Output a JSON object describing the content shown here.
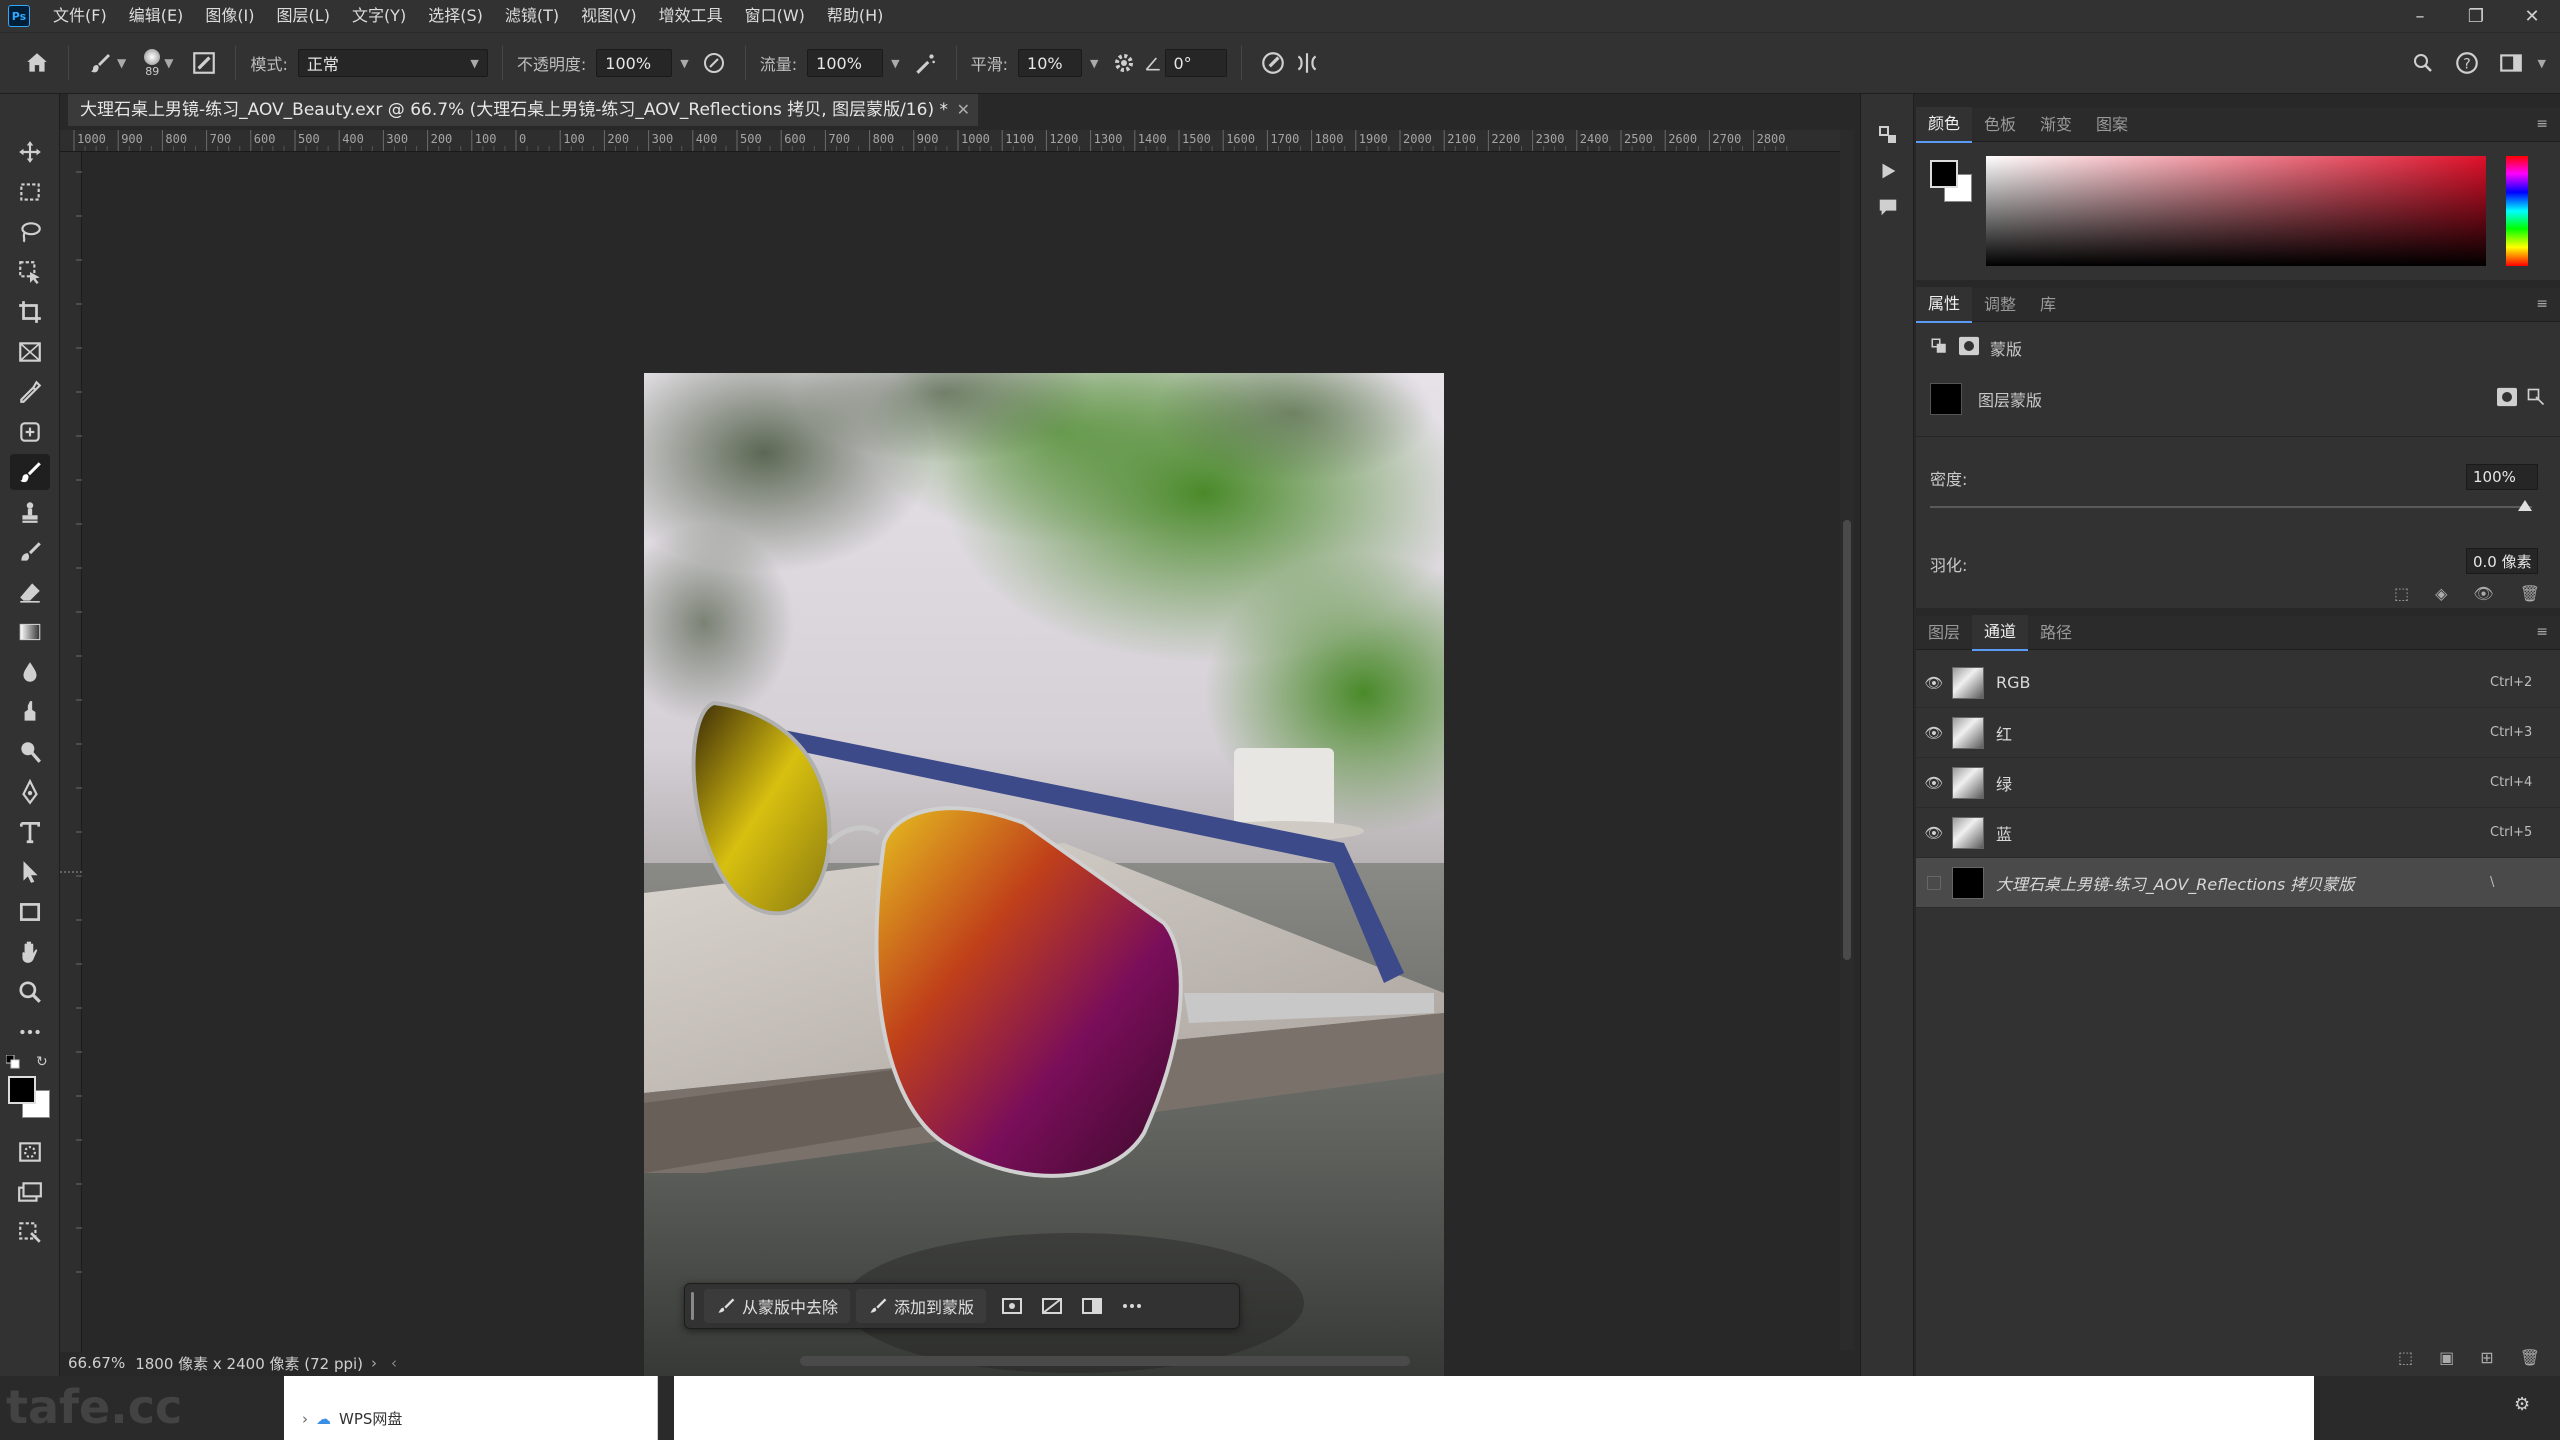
{
  "menu": {
    "items": [
      "文件(F)",
      "编辑(E)",
      "图像(I)",
      "图层(L)",
      "文字(Y)",
      "选择(S)",
      "滤镜(T)",
      "视图(V)",
      "增效工具",
      "窗口(W)",
      "帮助(H)"
    ]
  },
  "options": {
    "brush_size": "89",
    "mode_label": "模式:",
    "mode_value": "正常",
    "opacity_label": "不透明度:",
    "opacity_value": "100%",
    "flow_label": "流量:",
    "flow_value": "100%",
    "smooth_label": "平滑:",
    "smooth_value": "10%",
    "angle_value": "0°"
  },
  "document": {
    "tab_title": "大理石桌上男镜-练习_AOV_Beauty.exr @ 66.7% (大理石桌上男镜-练习_AOV_Reflections 拷贝, 图层蒙版/16) *",
    "zoom": "66.67%",
    "dimensions": "1800 像素 x 2400 像素 (72 ppi)"
  },
  "ruler": {
    "top_labels": [
      "1000",
      "900",
      "800",
      "700",
      "600",
      "500",
      "400",
      "300",
      "200",
      "100",
      "0",
      "100",
      "200",
      "300",
      "400",
      "500",
      "600",
      "700",
      "800",
      "900",
      "1000",
      "1100",
      "1200",
      "1300",
      "1400",
      "1500",
      "1600",
      "1700",
      "1800",
      "1900",
      "2000",
      "2100",
      "2200",
      "2300",
      "2400",
      "2500",
      "2600",
      "2700",
      "2800"
    ]
  },
  "taskbar": {
    "remove_label": "从蒙版中去除",
    "add_label": "添加到蒙版"
  },
  "color_panel": {
    "tabs": [
      "颜色",
      "色板",
      "渐变",
      "图案"
    ],
    "fg_color": "#000000",
    "bg_color": "#ffffff"
  },
  "properties_panel": {
    "tabs": [
      "属性",
      "调整",
      "库"
    ],
    "mask_header": "蒙版",
    "layer_mask_label": "图层蒙版",
    "density_label": "密度:",
    "density_value": "100%",
    "feather_label": "羽化:",
    "feather_value": "0.0 像素"
  },
  "channels_panel": {
    "tabs": [
      "图层",
      "通道",
      "路径"
    ],
    "channels": [
      {
        "name": "RGB",
        "shortcut": "Ctrl+2"
      },
      {
        "name": "红",
        "shortcut": "Ctrl+3"
      },
      {
        "name": "绿",
        "shortcut": "Ctrl+4"
      },
      {
        "name": "蓝",
        "shortcut": "Ctrl+5"
      }
    ],
    "mask_channel": {
      "name": "大理石桌上男镜-练习_AOV_Reflections 拷贝蒙版",
      "shortcut": "\\"
    }
  },
  "bottom": {
    "wps_label": "WPS网盘",
    "watermark": "tafe.cc"
  }
}
